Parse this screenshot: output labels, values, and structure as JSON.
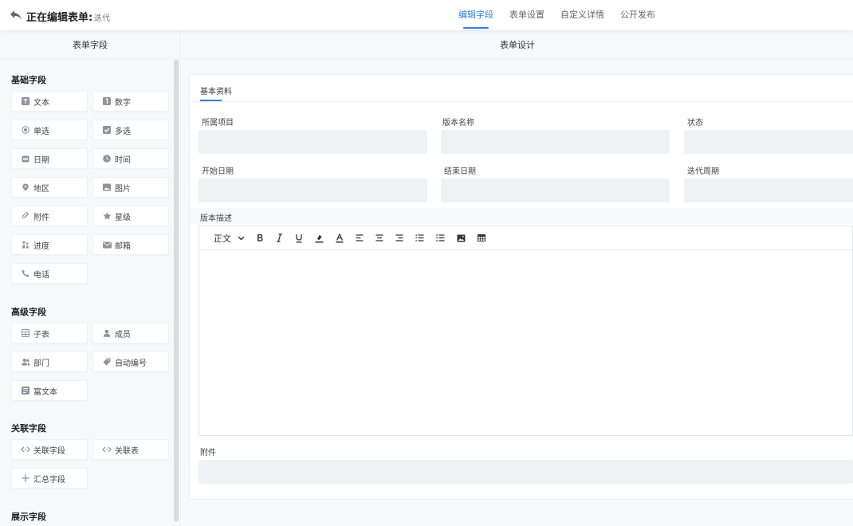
{
  "header": {
    "title": "正在编辑表单:",
    "subtitle": "迭代",
    "tabs": [
      {
        "label": "编辑字段",
        "active": true
      },
      {
        "label": "表单设置",
        "active": false
      },
      {
        "label": "自定义详情",
        "active": false
      },
      {
        "label": "公开发布",
        "active": false
      }
    ]
  },
  "left_panel": {
    "title": "表单字段",
    "sections": {
      "basic": {
        "title": "基础字段",
        "items": [
          {
            "label": "文本",
            "icon": "text-icon"
          },
          {
            "label": "数字",
            "icon": "number-icon"
          },
          {
            "label": "单选",
            "icon": "radio-icon"
          },
          {
            "label": "多选",
            "icon": "checkbox-icon"
          },
          {
            "label": "日期",
            "icon": "calendar-icon"
          },
          {
            "label": "时间",
            "icon": "clock-icon"
          },
          {
            "label": "地区",
            "icon": "location-icon"
          },
          {
            "label": "图片",
            "icon": "image-icon"
          },
          {
            "label": "附件",
            "icon": "paperclip-icon"
          },
          {
            "label": "星级",
            "icon": "star-icon"
          },
          {
            "label": "进度",
            "icon": "progress-icon"
          },
          {
            "label": "邮箱",
            "icon": "mail-icon"
          },
          {
            "label": "电话",
            "icon": "phone-icon"
          }
        ]
      },
      "advanced": {
        "title": "高级字段",
        "items": [
          {
            "label": "子表",
            "icon": "table-icon"
          },
          {
            "label": "成员",
            "icon": "user-icon"
          },
          {
            "label": "部门",
            "icon": "group-icon"
          },
          {
            "label": "自动编号",
            "icon": "tag-icon"
          },
          {
            "label": "富文本",
            "icon": "richtext-icon"
          }
        ]
      },
      "relation": {
        "title": "关联字段",
        "items": [
          {
            "label": "关联字段",
            "icon": "link-icon"
          },
          {
            "label": "关联表",
            "icon": "link-icon"
          },
          {
            "label": "汇总字段",
            "icon": "plus-icon"
          }
        ]
      },
      "display": {
        "title": "展示字段"
      }
    }
  },
  "right_panel": {
    "title": "表单设计",
    "form_tab": "基本资料",
    "fields": {
      "project": "所属项目",
      "version_name": "版本名称",
      "status": "状态",
      "start_date": "开始日期",
      "end_date": "结束日期",
      "cycle": "迭代周期",
      "description": "版本描述",
      "attachment": "附件"
    },
    "editor": {
      "paragraph_label": "正文"
    }
  },
  "colors": {
    "accent": "#2f7fe8",
    "panel_bg": "#f7f8fa",
    "input_bg": "#f0f1f4"
  }
}
